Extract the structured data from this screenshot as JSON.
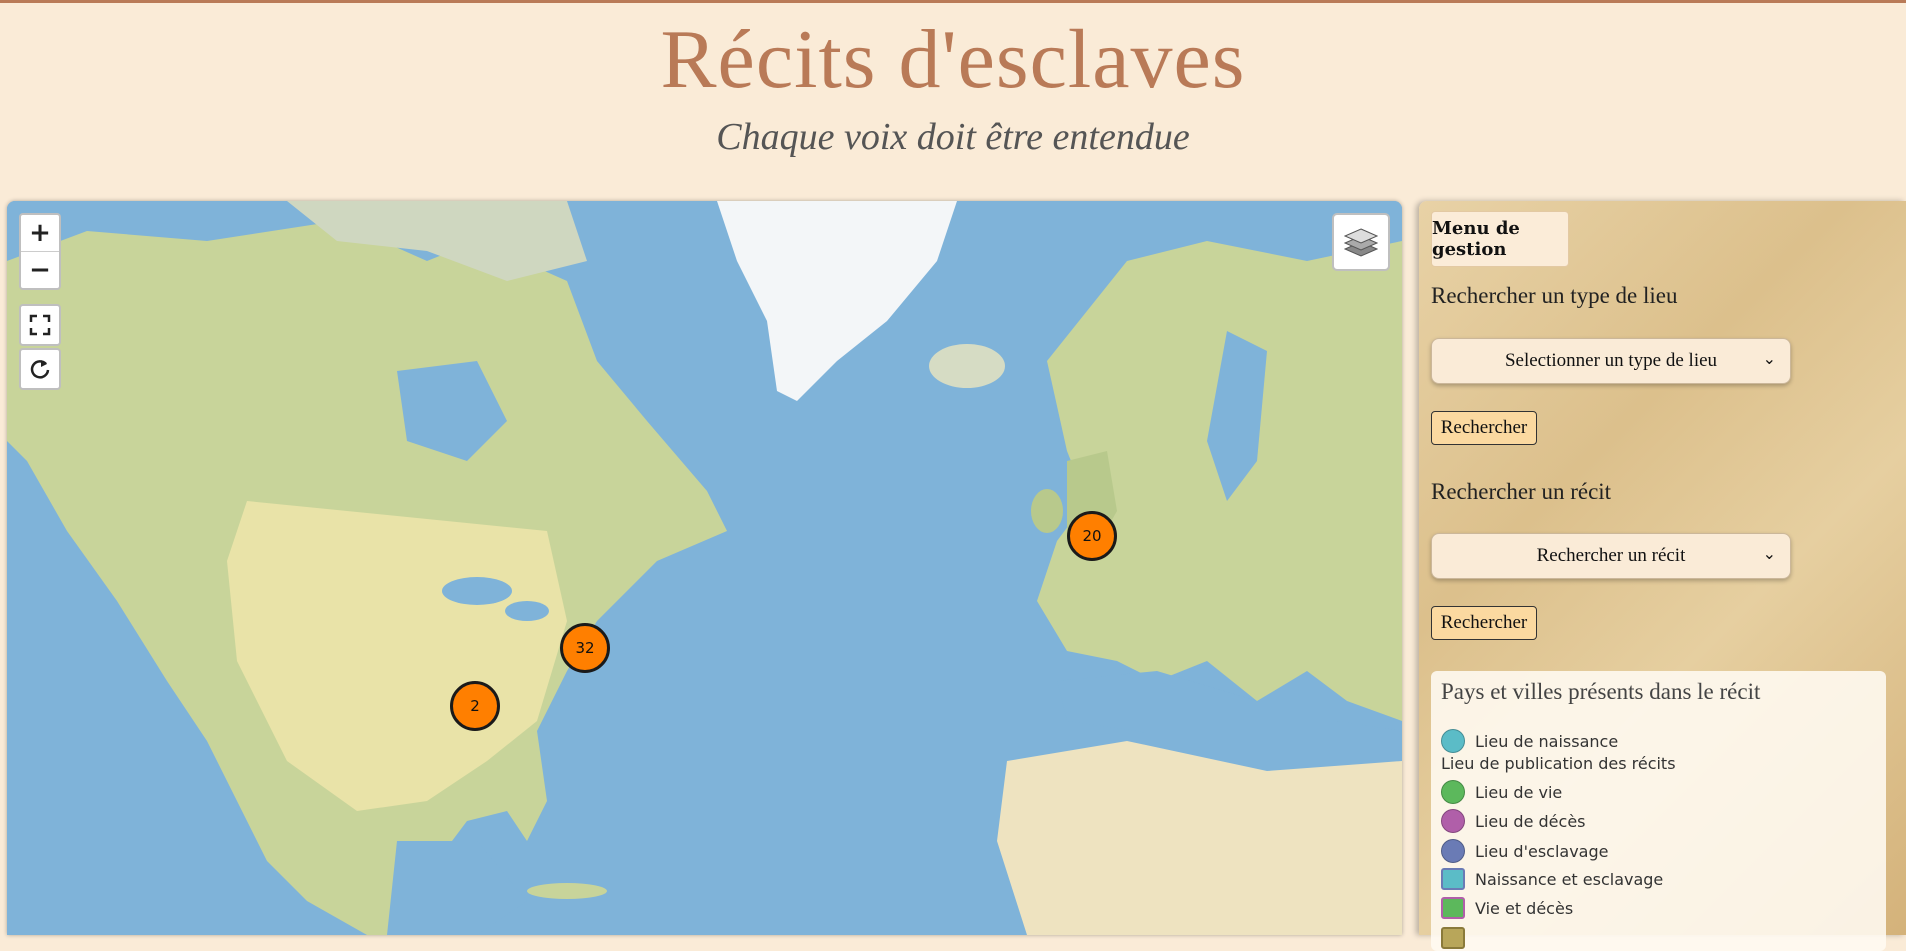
{
  "header": {
    "title": "Récits d'esclaves",
    "subtitle": "Chaque voix doit être entendue"
  },
  "map": {
    "zoom_in": "+",
    "zoom_out": "−",
    "clusters": [
      {
        "count": "20"
      },
      {
        "count": "32"
      },
      {
        "count": "2"
      }
    ],
    "cluster_color": "#ff7f00"
  },
  "panel": {
    "menu_button": "Menu de gestion",
    "place_type_label": "Rechercher un type de lieu",
    "place_type_select": "Selectionner un type de lieu",
    "search_button_1": "Rechercher",
    "story_label": "Rechercher un récit",
    "story_select": "Rechercher un récit",
    "search_button_2": "Rechercher",
    "legend": {
      "title": "Pays et villes présents dans le récit",
      "items": [
        {
          "label": "Lieu de naissance",
          "color": "#5bbcc7",
          "shape": "dot"
        },
        {
          "label": "Lieu de publication des récits",
          "color": "",
          "shape": "none"
        },
        {
          "label": "Lieu de vie",
          "color": "#5cb85c",
          "shape": "dot"
        },
        {
          "label": "Lieu de décès",
          "color": "#b05fa9",
          "shape": "dot"
        },
        {
          "label": "Lieu d'esclavage",
          "color": "#6a7bb5",
          "shape": "dot"
        },
        {
          "label": "Naissance et esclavage",
          "color": "#5bbcc7",
          "border": "#6a7bb5",
          "shape": "square"
        },
        {
          "label": "Vie et décès",
          "color": "#5cb85c",
          "border": "#b05fa9",
          "shape": "square"
        }
      ]
    }
  }
}
